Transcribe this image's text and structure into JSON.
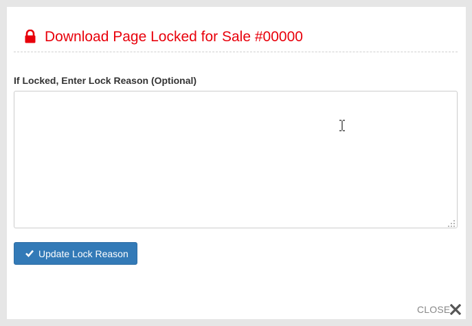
{
  "header": {
    "title": "Download Page Locked for Sale #00000",
    "lock_icon": "lock-icon",
    "title_color": "#e8000b"
  },
  "form": {
    "label": "If Locked, Enter Lock Reason (Optional)",
    "lock_reason_value": "",
    "submit_label": "Update Lock Reason",
    "submit_icon": "check-icon",
    "button_color": "#337ab7"
  },
  "footer": {
    "close_label": "CLOSE",
    "close_icon": "close-icon"
  }
}
